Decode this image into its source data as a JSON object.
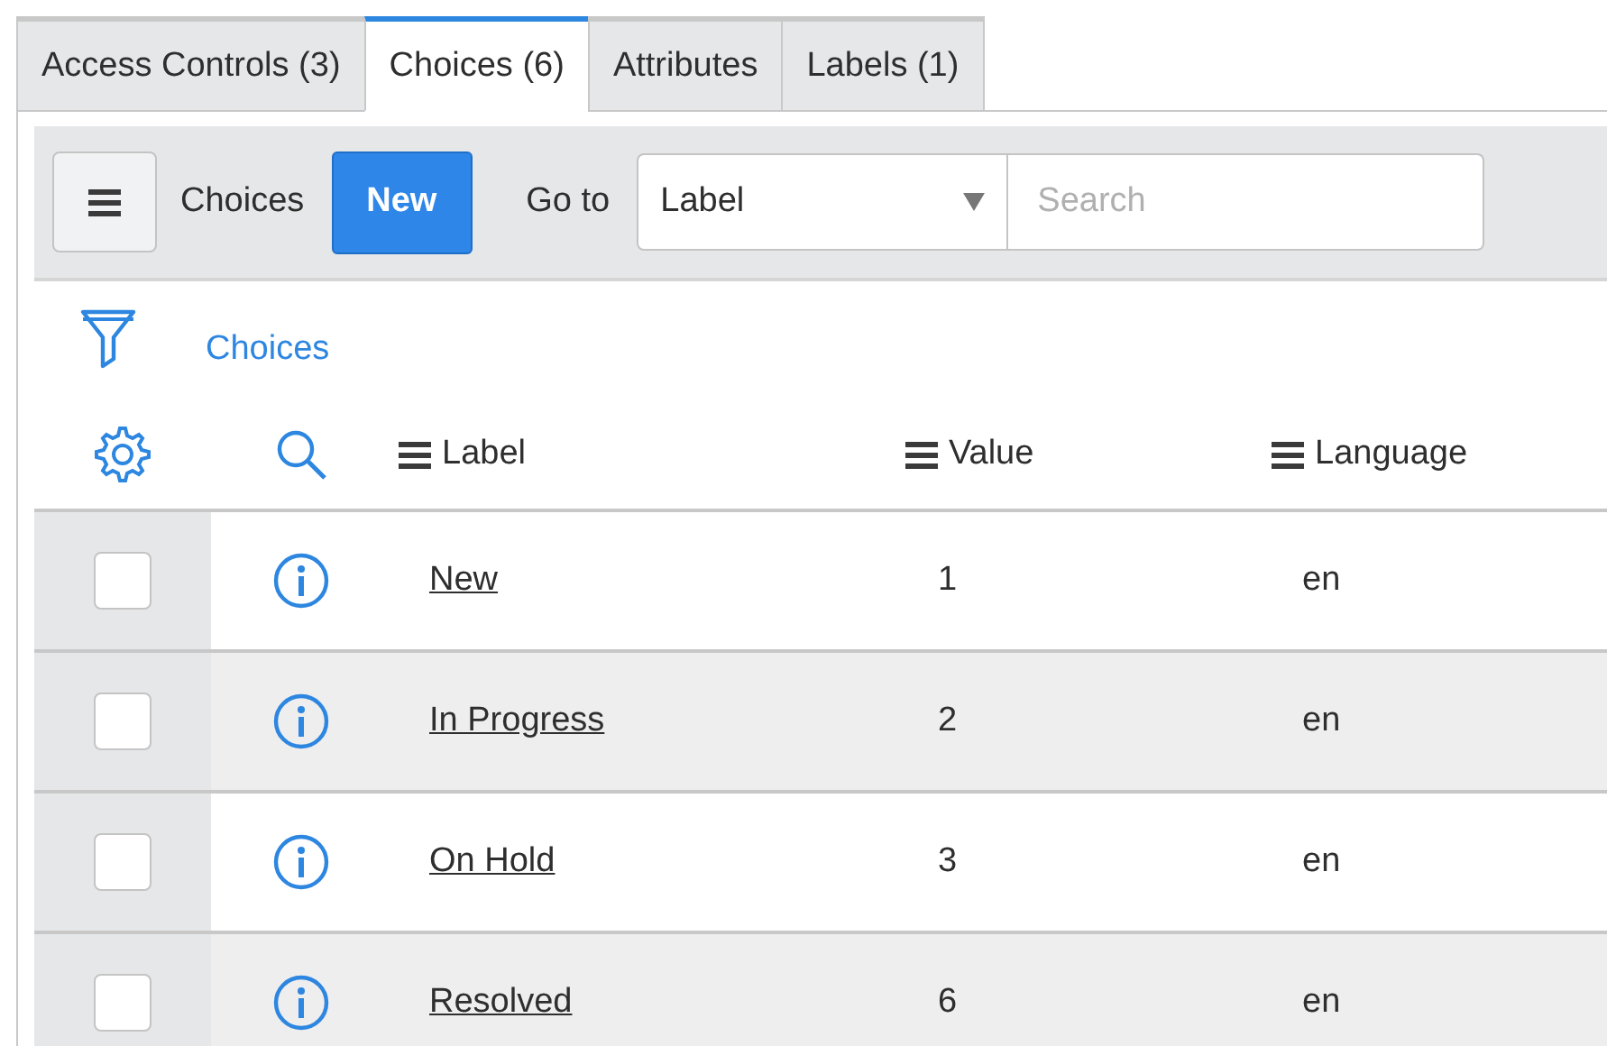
{
  "tabs": [
    {
      "label": "Access Controls (3)",
      "selected": false
    },
    {
      "label": "Choices (6)",
      "selected": true
    },
    {
      "label": "Attributes",
      "selected": false
    },
    {
      "label": "Labels (1)",
      "selected": false
    }
  ],
  "toolbar": {
    "title": "Choices",
    "new_button": "New",
    "goto_label": "Go to",
    "goto_field": "Label",
    "search": {
      "placeholder": "Search"
    }
  },
  "filter": {
    "breadcrumb": "Choices"
  },
  "table": {
    "columns": [
      "Label",
      "Value",
      "Language"
    ],
    "rows": [
      {
        "checked": false,
        "label": "New",
        "value": "1",
        "language": "en"
      },
      {
        "checked": false,
        "label": "In Progress",
        "value": "2",
        "language": "en"
      },
      {
        "checked": false,
        "label": "On Hold",
        "value": "3",
        "language": "en"
      },
      {
        "checked": false,
        "label": "Resolved",
        "value": "6",
        "language": "en"
      }
    ]
  }
}
